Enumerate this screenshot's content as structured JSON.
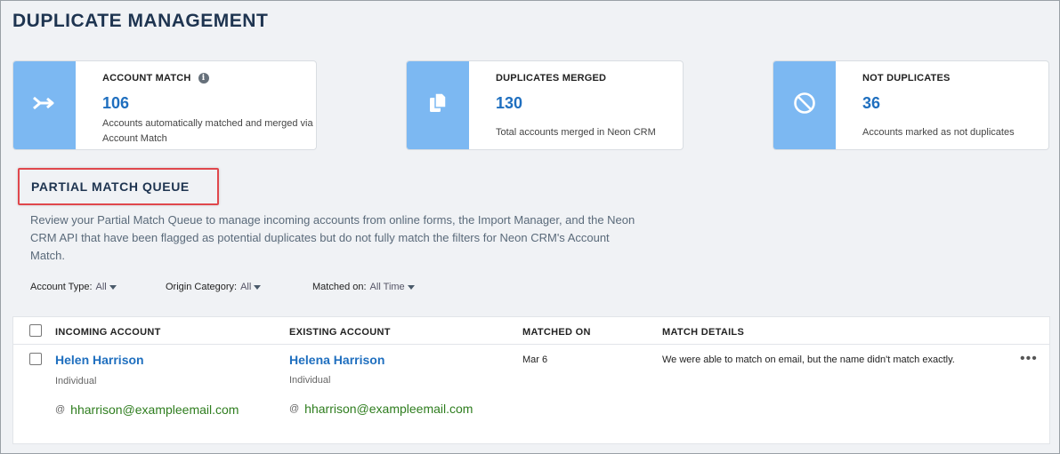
{
  "page": {
    "title": "DUPLICATE MANAGEMENT"
  },
  "cards": [
    {
      "label": "ACCOUNT MATCH",
      "value": "106",
      "description": "Accounts automatically matched and merged via Account Match",
      "icon": "merge-arrow-icon",
      "has_info": true
    },
    {
      "label": "DUPLICATES MERGED",
      "value": "130",
      "description": "Total accounts merged in Neon CRM",
      "icon": "copy-documents-icon"
    },
    {
      "label": "NOT DUPLICATES",
      "value": "36",
      "description": "Accounts marked as not duplicates",
      "icon": "prohibited-icon"
    }
  ],
  "queue": {
    "title": "PARTIAL MATCH QUEUE",
    "description": "Review your Partial Match Queue to manage incoming accounts from online forms, the Import Manager, and the Neon CRM API that have been flagged as potential duplicates but do not fully match the filters for Neon CRM's Account Match."
  },
  "filters": [
    {
      "label": "Account Type:",
      "value": "All"
    },
    {
      "label": "Origin Category:",
      "value": "All"
    },
    {
      "label": "Matched on:",
      "value": "All Time"
    }
  ],
  "table": {
    "columns": [
      "INCOMING ACCOUNT",
      "EXISTING ACCOUNT",
      "MATCHED ON",
      "MATCH DETAILS"
    ],
    "rows": [
      {
        "incoming": {
          "name": "Helen Harrison",
          "type": "Individual",
          "email": "hharrison@exampleemail.com"
        },
        "existing": {
          "name": "Helena Harrison",
          "type": "Individual",
          "email": "hharrison@exampleemail.com"
        },
        "matched_on": "Mar 6",
        "details": "We were able to match on email, but the name didn't match exactly."
      }
    ]
  },
  "colors": {
    "accent": "#1f6fbf",
    "band": "#7cb8f2",
    "title": "#1e3450",
    "highlight": "#e0474c",
    "email": "#2e7d1e"
  }
}
